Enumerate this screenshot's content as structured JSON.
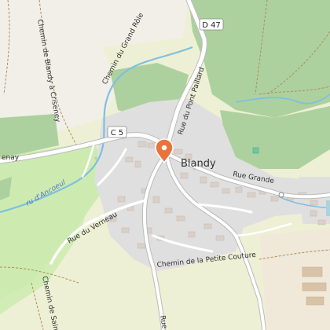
{
  "map": {
    "place_name": "Blandy",
    "road_shields": [
      "D 47",
      "C 5"
    ],
    "road_labels": {
      "grand_role": "Chemin du Grand Rôle",
      "blandy_criseney": "Chemin de Blandy à Criseney",
      "pont_paillard": "Rue du Pont Paillard",
      "rue_grande": "Rue Grande",
      "rue_verneau": "Rue du Verneau",
      "petite_couture": "Chemin de la Petite Couture",
      "saint_m": "Chemin de Saint-M",
      "enay": "enay",
      "rue_bottom": "Rue"
    },
    "water_labels": {
      "ancoeul": "ru d'Ancoeul"
    },
    "marker": {
      "name": "location-marker",
      "color": "#e8743b"
    },
    "colors": {
      "background": "#f2efe9",
      "residential": "#e0dfdf",
      "forest": "#add19e",
      "grass": "#cdebb0",
      "water": "#aad3df",
      "river": "#7ec0e0",
      "farmland": "#eef0d5",
      "road": "#ffffff"
    }
  }
}
